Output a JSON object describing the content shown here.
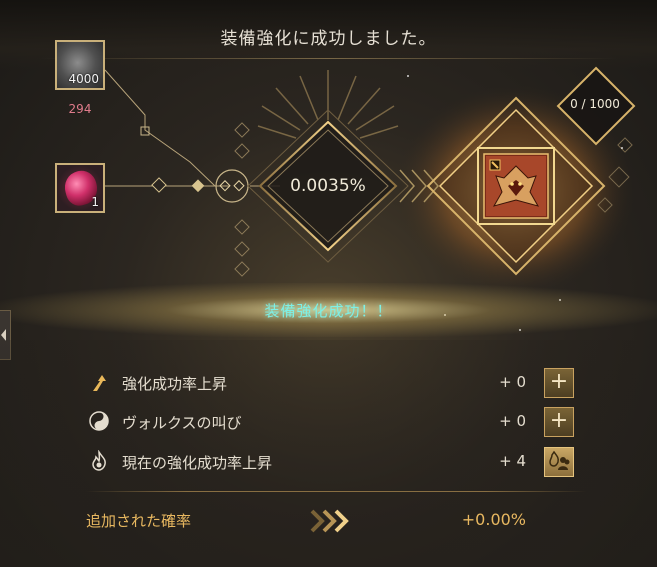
{
  "header": {
    "title": "装備強化に成功しました。"
  },
  "materials": {
    "stone": {
      "icon": "black-stone-icon",
      "count": "4000",
      "owned": "294"
    },
    "gem": {
      "icon": "red-gem-icon",
      "count": "1"
    }
  },
  "enhance": {
    "rate": "0.0035%",
    "counter": "0 / 1000",
    "equipment_icon": "dragon-equipment-icon"
  },
  "banner": {
    "text": "装備強化成功！！"
  },
  "bonuses": [
    {
      "icon": "arrow-up-icon",
      "label": "強化成功率上昇",
      "value": "+ 0",
      "button": "plus-icon"
    },
    {
      "icon": "yin-yang-icon",
      "label": "ヴォルクスの叫び",
      "value": "+ 0",
      "button": "plus-icon"
    },
    {
      "icon": "flame-icon",
      "label": "現在の強化成功率上昇",
      "value": "+ 4",
      "button": "flame-people-icon"
    }
  ],
  "added": {
    "label": "追加された確率",
    "value": "+0.00%"
  },
  "colors": {
    "accent": "#e8b860",
    "success": "#7ef0e6",
    "count_red": "#e07c8c"
  }
}
